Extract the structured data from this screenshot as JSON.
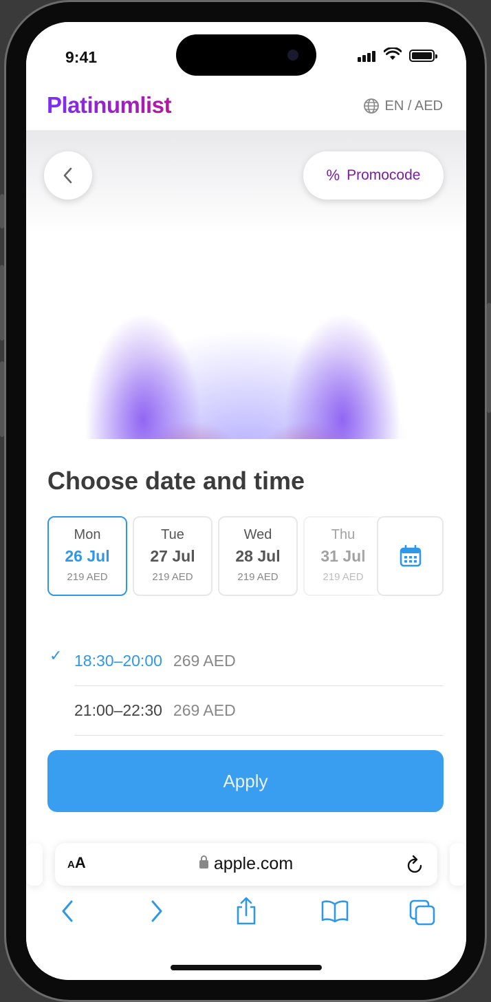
{
  "status_bar": {
    "time": "9:41"
  },
  "header": {
    "logo": "Platinumlist",
    "language": "EN / AED"
  },
  "hero": {
    "promo_label": "Promocode",
    "promo_symbol": "%"
  },
  "sheet": {
    "title": "Choose date and time",
    "dates": [
      {
        "dow": "Mon",
        "date": "26 Jul",
        "price": "219 AED",
        "selected": true
      },
      {
        "dow": "Tue",
        "date": "27 Jul",
        "price": "219 AED",
        "selected": false
      },
      {
        "dow": "Wed",
        "date": "28 Jul",
        "price": "219 AED",
        "selected": false
      },
      {
        "dow": "Thu",
        "date": "31 Jul",
        "price": "219 AED",
        "selected": false
      }
    ],
    "slots": [
      {
        "time": "18:30–20:00",
        "price": "269 AED",
        "selected": true
      },
      {
        "time": "21:00–22:30",
        "price": "269 AED",
        "selected": false
      }
    ],
    "apply_label": "Apply"
  },
  "browser": {
    "text_size": "AA",
    "url": "apple.com"
  },
  "colors": {
    "accent": "#2f97e8",
    "apply_button": "#3a9ef0",
    "brand": "#7b1fa2"
  }
}
